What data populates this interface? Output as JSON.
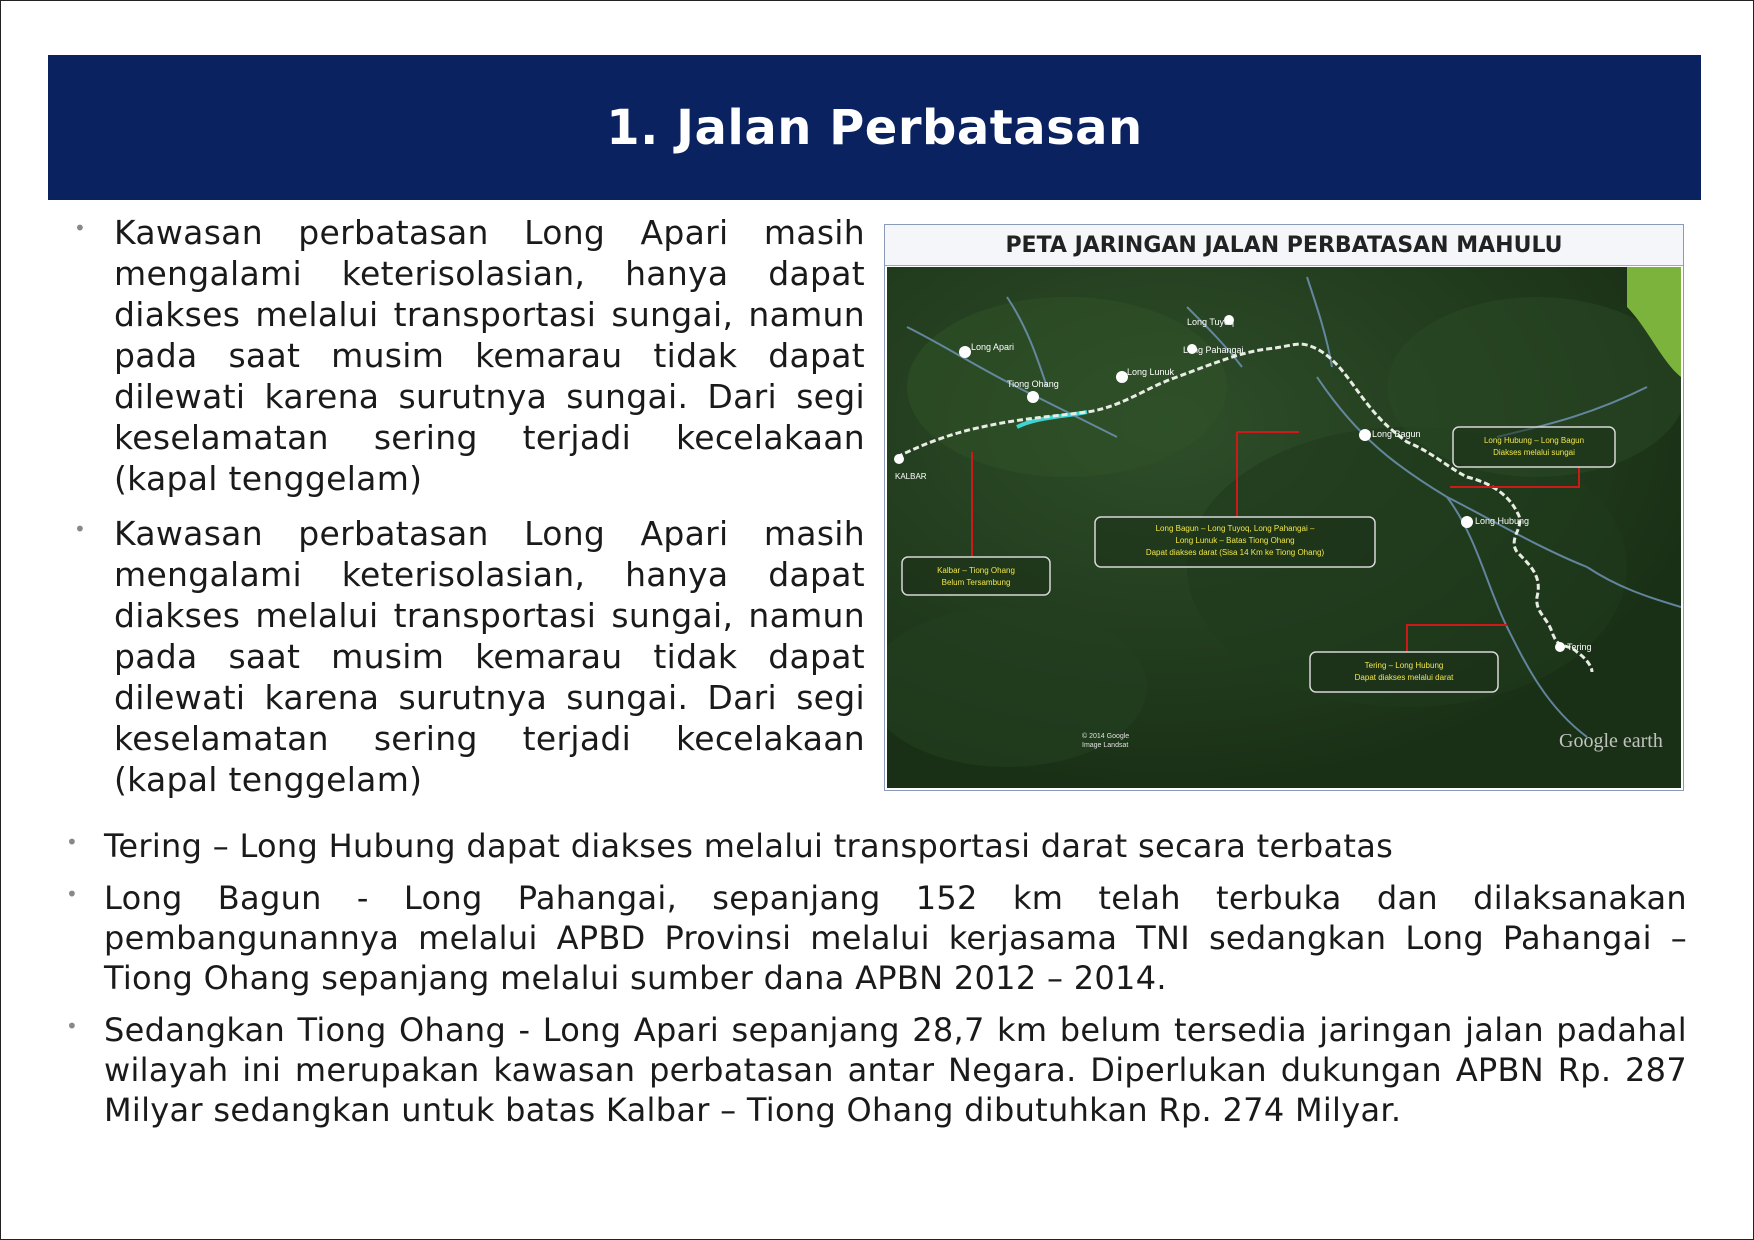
{
  "title": "1. Jalan Perbatasan",
  "top_bullets": [
    "Kawasan perbatasan Long Apari masih mengalami keterisolasian, hanya dapat diakses melalui transportasi sungai, namun pada saat musim kemarau tidak dapat dilewati karena surutnya sungai. Dari segi keselamatan sering terjadi kecelakaan (kapal tenggelam)",
    "Kawasan perbatasan Long Apari masih mengalami keterisolasian, hanya dapat diakses melalui transportasi sungai, namun pada saat musim kemarau tidak dapat dilewati karena surutnya sungai. Dari segi keselamatan sering terjadi kecelakaan (kapal tenggelam)"
  ],
  "bottom_bullets": [
    "Tering – Long Hubung dapat diakses melalui transportasi darat secara terbatas",
    "Long Bagun - Long Pahangai, sepanjang 152 km telah terbuka dan dilaksanakan pembangunannya melalui APBD Provinsi melalui kerjasama TNI sedangkan Long Pahangai – Tiong Ohang sepanjang melalui sumber dana APBN 2012 – 2014.",
    "Sedangkan Tiong Ohang - Long Apari sepanjang 28,7 km belum tersedia jaringan jalan padahal wilayah ini merupakan kawasan perbatasan antar Negara. Diperlukan dukungan APBN Rp. 287 Milyar sedangkan untuk batas Kalbar – Tiong Ohang dibutuhkan Rp. 274 Milyar."
  ],
  "map": {
    "title": "PETA JARINGAN JALAN PERBATASAN MAHULU",
    "places": {
      "long_apari": "Long Apari",
      "tiong_ohang": "Tiong Ohang",
      "long_lunuk": "Long Lunuk",
      "long_tuyoq": "Long Tuyoq",
      "long_pahangai": "Long Pahangai",
      "long_bagun": "Long Bagun",
      "long_hubung": "Long Hubung",
      "tering": "Tering",
      "kalbar": "KALBAR"
    },
    "callouts": {
      "kalbar_tiong_1": "Kalbar – Tiong Ohang",
      "kalbar_tiong_2": "Belum Tersambung",
      "bagun_1": "Long Bagun – Long Tuyoq, Long Pahangai –",
      "bagun_2": "Long Lunuk – Batas Tiong Ohang",
      "bagun_3": "Dapat diakses darat (Sisa 14 Km ke Tiong Ohang)",
      "hubung_bagun_1": "Long Hubung – Long Bagun",
      "hubung_bagun_2": "Diakses melalui sungai",
      "tering_1": "Tering – Long Hubung",
      "tering_2": "Dapat diakses melalui darat"
    },
    "copyright_1": "© 2014 Google",
    "copyright_2": "Image Landsat",
    "watermark": "Google earth",
    "colors": {
      "terrain": "#24401f",
      "road": "#e8ece4",
      "river": "#7aa0c0",
      "leader_line": "#cc1a1a",
      "callout_border": "#d8d8d8",
      "callout_text": "#f2e64a"
    }
  },
  "colors": {
    "title_bar": "#0a2260",
    "title_text": "#ffffff"
  }
}
